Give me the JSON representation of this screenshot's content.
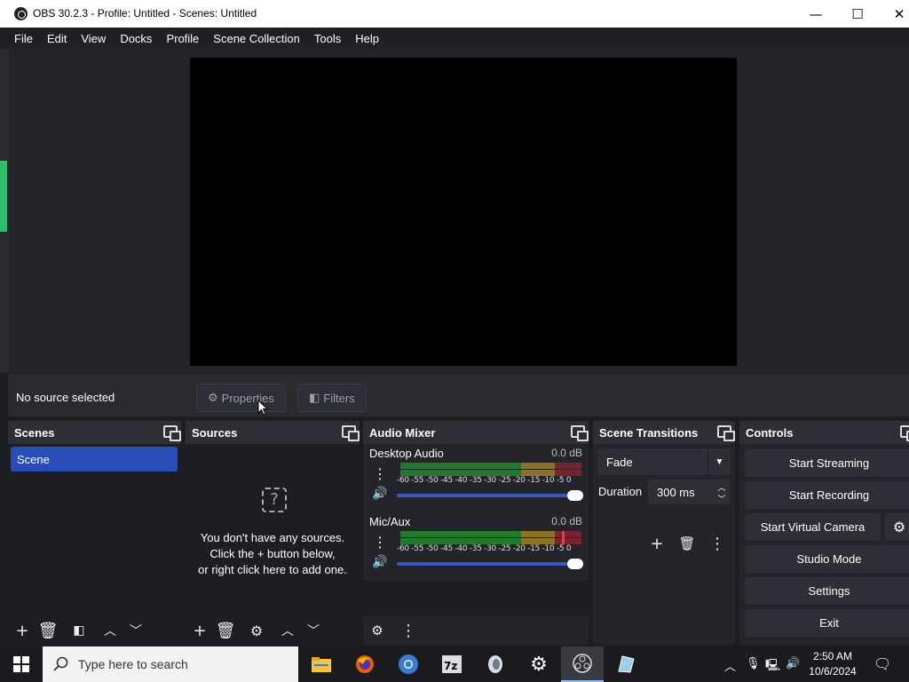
{
  "window": {
    "title": "OBS 30.2.3 - Profile: Untitled - Scenes: Untitled",
    "minimize": "—",
    "maximize": "☐",
    "close": "✕"
  },
  "menu": [
    "File",
    "Edit",
    "View",
    "Docks",
    "Profile",
    "Scene Collection",
    "Tools",
    "Help"
  ],
  "source_bar": {
    "status": "No source selected",
    "properties": "Properties",
    "filters": "Filters"
  },
  "scenes": {
    "title": "Scenes",
    "items": [
      "Scene"
    ]
  },
  "sources": {
    "title": "Sources",
    "empty_line1": "You don't have any sources.",
    "empty_line2": "Click the + button below,",
    "empty_line3": "or right click here to add one."
  },
  "audio_mixer": {
    "title": "Audio Mixer",
    "channels": [
      {
        "name": "Desktop Audio",
        "level": "0.0 dB"
      },
      {
        "name": "Mic/Aux",
        "level": "0.0 dB"
      }
    ],
    "ticks": "-60 -55 -50 -45 -40 -35 -30 -25 -20 -15 -10 -5 0"
  },
  "scene_transitions": {
    "title": "Scene Transitions",
    "selected": "Fade",
    "duration_label": "Duration",
    "duration_value": "300 ms"
  },
  "controls": {
    "title": "Controls",
    "start_streaming": "Start Streaming",
    "start_recording": "Start Recording",
    "start_virtual_camera": "Start Virtual Camera",
    "studio_mode": "Studio Mode",
    "settings": "Settings",
    "exit": "Exit"
  },
  "taskbar": {
    "search_placeholder": "Type here to search",
    "time": "2:50 AM",
    "date": "10/6/2024"
  },
  "colors": {
    "accent": "#284cb8",
    "dock_header": "#2e2f36",
    "background": "#1c1d22"
  }
}
